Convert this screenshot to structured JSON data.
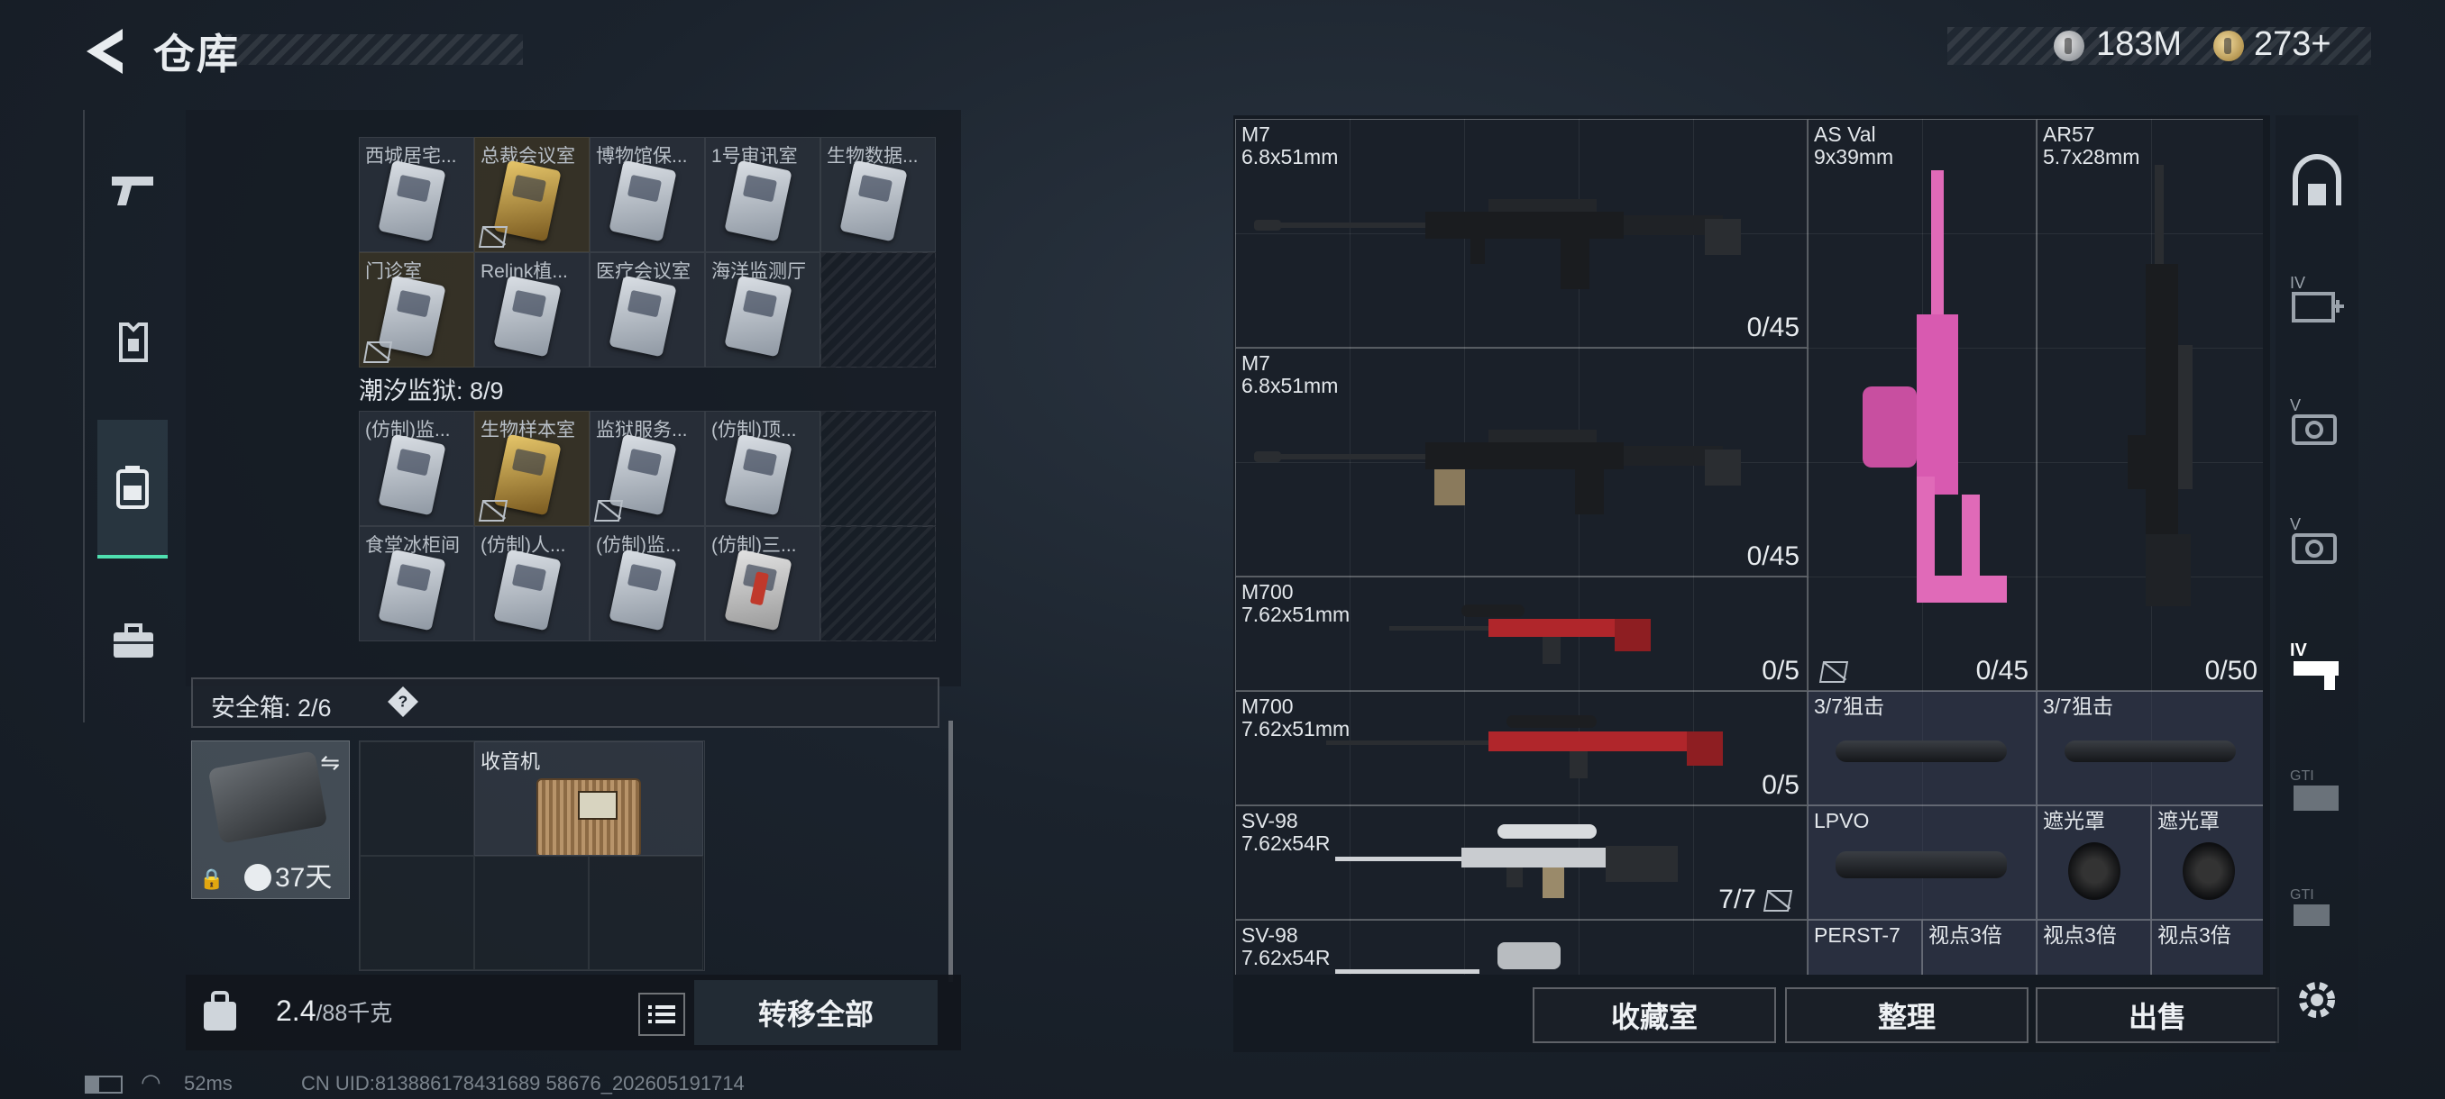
{
  "header": {
    "title": "仓库",
    "silver": "183M",
    "gold": "273+"
  },
  "left_nav": {
    "items": [
      "weapons",
      "bag",
      "backpack",
      "case"
    ]
  },
  "storage": {
    "group1_rows": [
      [
        "西城居宅...",
        "总裁会议室",
        "博物馆保...",
        "1号审讯室",
        "生物数据..."
      ],
      [
        "门诊室",
        "Relink植...",
        "医疗会议室",
        "海洋监测厅",
        ""
      ]
    ],
    "group2_title": "潮汐监狱: 8/9",
    "group2_rows": [
      [
        "(仿制)监...",
        "生物样本室",
        "监狱服务...",
        "(仿制)顶...",
        ""
      ],
      [
        "食堂冰柜间",
        "(仿制)人...",
        "(仿制)监...",
        "(仿制)三...",
        ""
      ]
    ]
  },
  "safe": {
    "label": "安全箱: 2/6",
    "help": "?",
    "days": "37天",
    "item_label": "收音机"
  },
  "footer_left": {
    "weight_value": "2.4",
    "weight_max": "/88千克",
    "transfer_all": "转移全部"
  },
  "status": {
    "ping": "52ms",
    "uid": "CN UID:813886178431689 58676_202605191714"
  },
  "weapons": [
    {
      "name": "M7",
      "caliber": "6.8x51mm",
      "ammo": "0/45"
    },
    {
      "name": "M7",
      "caliber": "6.8x51mm",
      "ammo": "0/45"
    },
    {
      "name": "M700",
      "caliber": "7.62x51mm",
      "ammo": "0/5"
    },
    {
      "name": "M700",
      "caliber": "7.62x51mm",
      "ammo": "0/5"
    },
    {
      "name": "SV-98",
      "caliber": "7.62x54R",
      "ammo": "7/7"
    },
    {
      "name": "SV-98",
      "caliber": "7.62x54R",
      "ammo": ""
    },
    {
      "name": "AS Val",
      "caliber": "9x39mm",
      "ammo": "0/45"
    },
    {
      "name": "AR57",
      "caliber": "5.7x28mm",
      "ammo": "0/50"
    }
  ],
  "attachments": {
    "scope_a": "3/7狙击",
    "scope_b": "3/7狙击",
    "lpvo": "LPVO",
    "shade_a": "遮光罩",
    "shade_b": "遮光罩",
    "perst": "PERST-7",
    "dot_a": "视点3倍",
    "dot_b": "视点3倍",
    "dot_c": "视点3倍"
  },
  "actions": {
    "collection": "收藏室",
    "sort": "整理",
    "sell": "出售"
  },
  "colors": {
    "accent_green": "#4fe0b0",
    "gold_tile": "#6e5a28",
    "pink_gun": "#e06ab8"
  }
}
